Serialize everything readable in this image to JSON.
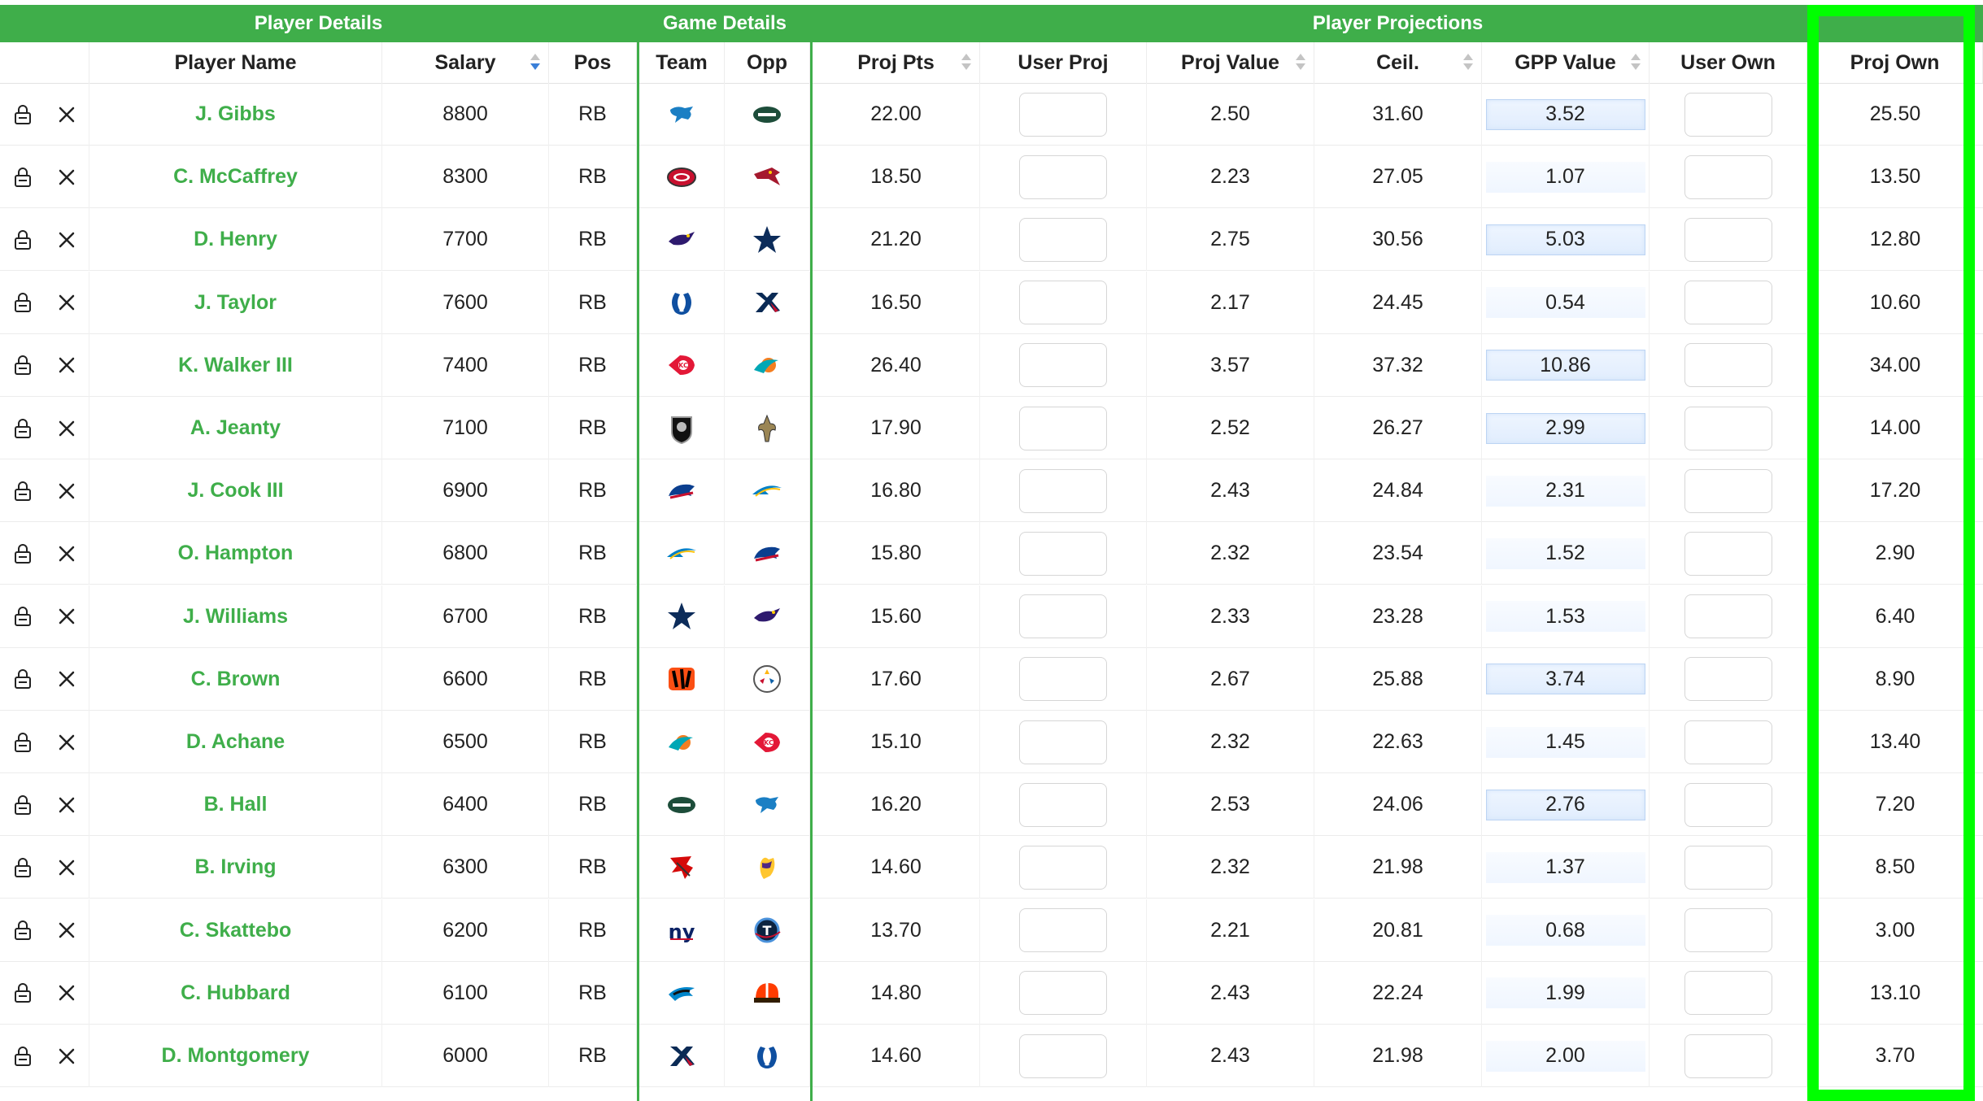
{
  "groups": {
    "player_details": "Player Details",
    "game_details": "Game Details",
    "player_projections": "Player Projections"
  },
  "columns": {
    "player_name": "Player Name",
    "salary": "Salary",
    "pos": "Pos",
    "team": "Team",
    "opp": "Opp",
    "proj_pts": "Proj Pts",
    "user_proj": "User Proj",
    "proj_value": "Proj Value",
    "ceil": "Ceil.",
    "gpp_value": "GPP Value",
    "user_own": "User Own",
    "proj_own": "Proj Own"
  },
  "colors": {
    "accent": "#3fae4a",
    "highlight": "#00ff00",
    "sort_active": "#3a7fd8"
  },
  "rows": [
    {
      "name": "J. Gibbs",
      "salary": "8800",
      "pos": "RB",
      "team": "DET",
      "opp": "NYJ",
      "proj_pts": "22.00",
      "proj_value": "2.50",
      "ceil": "31.60",
      "gpp": "3.52",
      "gpp_hi": true,
      "proj_own": "25.50"
    },
    {
      "name": "C. McCaffrey",
      "salary": "8300",
      "pos": "RB",
      "team": "SF",
      "opp": "ARI",
      "proj_pts": "18.50",
      "proj_value": "2.23",
      "ceil": "27.05",
      "gpp": "1.07",
      "gpp_hi": false,
      "proj_own": "13.50"
    },
    {
      "name": "D. Henry",
      "salary": "7700",
      "pos": "RB",
      "team": "BAL",
      "opp": "DAL",
      "proj_pts": "21.20",
      "proj_value": "2.75",
      "ceil": "30.56",
      "gpp": "5.03",
      "gpp_hi": true,
      "proj_own": "12.80"
    },
    {
      "name": "J. Taylor",
      "salary": "7600",
      "pos": "RB",
      "team": "IND",
      "opp": "HOU",
      "proj_pts": "16.50",
      "proj_value": "2.17",
      "ceil": "24.45",
      "gpp": "0.54",
      "gpp_hi": false,
      "proj_own": "10.60"
    },
    {
      "name": "K. Walker III",
      "salary": "7400",
      "pos": "RB",
      "team": "KC",
      "opp": "MIA",
      "proj_pts": "26.40",
      "proj_value": "3.57",
      "ceil": "37.32",
      "gpp": "10.86",
      "gpp_hi": true,
      "proj_own": "34.00"
    },
    {
      "name": "A. Jeanty",
      "salary": "7100",
      "pos": "RB",
      "team": "LV",
      "opp": "NO",
      "proj_pts": "17.90",
      "proj_value": "2.52",
      "ceil": "26.27",
      "gpp": "2.99",
      "gpp_hi": true,
      "proj_own": "14.00"
    },
    {
      "name": "J. Cook III",
      "salary": "6900",
      "pos": "RB",
      "team": "BUF",
      "opp": "LAC",
      "proj_pts": "16.80",
      "proj_value": "2.43",
      "ceil": "24.84",
      "gpp": "2.31",
      "gpp_hi": false,
      "proj_own": "17.20"
    },
    {
      "name": "O. Hampton",
      "salary": "6800",
      "pos": "RB",
      "team": "LAC",
      "opp": "BUF",
      "proj_pts": "15.80",
      "proj_value": "2.32",
      "ceil": "23.54",
      "gpp": "1.52",
      "gpp_hi": false,
      "proj_own": "2.90"
    },
    {
      "name": "J. Williams",
      "salary": "6700",
      "pos": "RB",
      "team": "DAL",
      "opp": "BAL",
      "proj_pts": "15.60",
      "proj_value": "2.33",
      "ceil": "23.28",
      "gpp": "1.53",
      "gpp_hi": false,
      "proj_own": "6.40"
    },
    {
      "name": "C. Brown",
      "salary": "6600",
      "pos": "RB",
      "team": "CIN",
      "opp": "PIT",
      "proj_pts": "17.60",
      "proj_value": "2.67",
      "ceil": "25.88",
      "gpp": "3.74",
      "gpp_hi": true,
      "proj_own": "8.90"
    },
    {
      "name": "D. Achane",
      "salary": "6500",
      "pos": "RB",
      "team": "MIA",
      "opp": "KC",
      "proj_pts": "15.10",
      "proj_value": "2.32",
      "ceil": "22.63",
      "gpp": "1.45",
      "gpp_hi": false,
      "proj_own": "13.40"
    },
    {
      "name": "B. Hall",
      "salary": "6400",
      "pos": "RB",
      "team": "NYJ",
      "opp": "DET",
      "proj_pts": "16.20",
      "proj_value": "2.53",
      "ceil": "24.06",
      "gpp": "2.76",
      "gpp_hi": true,
      "proj_own": "7.20"
    },
    {
      "name": "B. Irving",
      "salary": "6300",
      "pos": "RB",
      "team": "TB",
      "opp": "MIN",
      "proj_pts": "14.60",
      "proj_value": "2.32",
      "ceil": "21.98",
      "gpp": "1.37",
      "gpp_hi": false,
      "proj_own": "8.50"
    },
    {
      "name": "C. Skattebo",
      "salary": "6200",
      "pos": "RB",
      "team": "NYG",
      "opp": "TEN",
      "proj_pts": "13.70",
      "proj_value": "2.21",
      "ceil": "20.81",
      "gpp": "0.68",
      "gpp_hi": false,
      "proj_own": "3.00"
    },
    {
      "name": "C. Hubbard",
      "salary": "6100",
      "pos": "RB",
      "team": "CAR",
      "opp": "CLE",
      "proj_pts": "14.80",
      "proj_value": "2.43",
      "ceil": "22.24",
      "gpp": "1.99",
      "gpp_hi": false,
      "proj_own": "13.10"
    },
    {
      "name": "D. Montgomery",
      "salary": "6000",
      "pos": "RB",
      "team": "HOU",
      "opp": "IND",
      "proj_pts": "14.60",
      "proj_value": "2.43",
      "ceil": "21.98",
      "gpp": "2.00",
      "gpp_hi": false,
      "proj_own": "3.70"
    }
  ]
}
